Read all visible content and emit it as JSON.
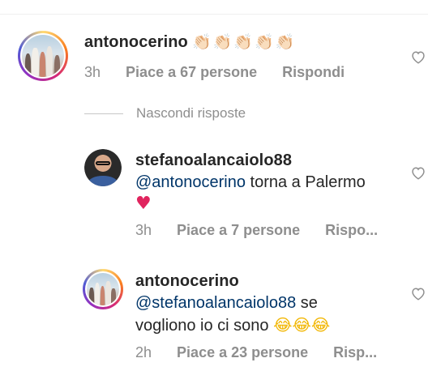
{
  "comments": [
    {
      "username": "antonocerino",
      "text": "",
      "emoji": [
        "👏🏻",
        "👏🏻",
        "👏🏻",
        "👏🏻",
        "👏🏻"
      ],
      "time": "3h",
      "likes": "Piace a 67 persone",
      "reply": "Rispondi"
    }
  ],
  "hide_replies_label": "Nascondi risposte",
  "replies": [
    {
      "username": "stefanoalancaiolo88",
      "mention": "@antonocerino",
      "text": " torna a Palermo",
      "emoji": "♥",
      "time": "3h",
      "likes": "Piace a 7 persone",
      "reply": "Rispo..."
    },
    {
      "username": "antonocerino",
      "mention": "@stefanoalancaiolo88",
      "text": " se",
      "line2": "vogliono io ci sono ",
      "emoji": [
        "😂",
        "😂",
        "😂"
      ],
      "time": "2h",
      "likes": "Piace a 23 persone",
      "reply": "Risp..."
    }
  ],
  "colors": {
    "text": "#262626",
    "meta": "#8e8e8e",
    "mention": "#003569",
    "heart": "#e0245e"
  }
}
